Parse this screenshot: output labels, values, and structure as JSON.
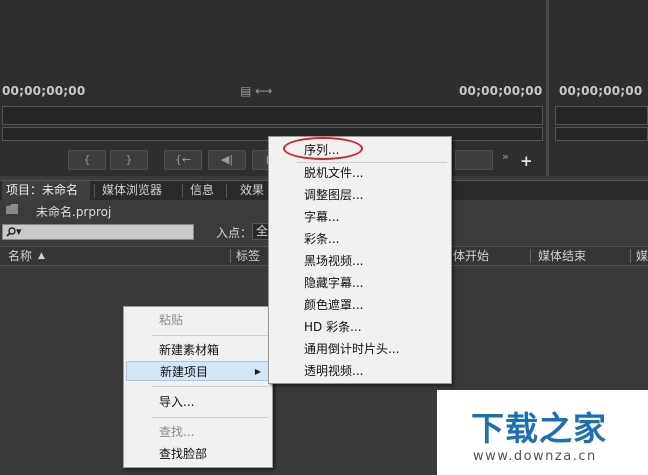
{
  "monitors": {
    "source_timecode": "00;00;00;00",
    "source_timecode_right": "00;00;00;00",
    "program_timecode": "00;00;00;00",
    "transport_buttons": [
      "{",
      "}",
      "{←",
      "◀|",
      "▶"
    ],
    "add_symbol": "+",
    "overflow_symbol": "»",
    "clip_icons": "▤ ⟷"
  },
  "panel": {
    "tabs": [
      {
        "label": "项目：未命名",
        "close": "×"
      },
      {
        "label": "媒体浏览器"
      },
      {
        "label": "信息"
      },
      {
        "label": "效果"
      }
    ],
    "project_file": "未命名.prproj",
    "folder_icon": "folder-icon",
    "search_icon": "▾",
    "in_point_label": "入点：",
    "in_point_value": "全",
    "columns": {
      "name": "名称",
      "sort_arrow": "▲",
      "label": "标签",
      "media_start": "体开始",
      "media_end": "媒体结束",
      "more": "媒"
    }
  },
  "context_menu": {
    "items": [
      {
        "label": "粘贴",
        "disabled": true
      },
      {
        "label": "新建素材箱",
        "disabled": false
      },
      {
        "label": "新建项目",
        "disabled": false,
        "submenu": "▶"
      },
      {
        "label": "导入...",
        "disabled": false
      },
      {
        "label": "查找...",
        "disabled": true
      },
      {
        "label": "查找脸部",
        "disabled": false
      }
    ]
  },
  "submenu": {
    "items": [
      "序列...",
      "脱机文件...",
      "调整图层...",
      "字幕...",
      "彩条...",
      "黑场视频...",
      "隐藏字幕...",
      "颜色遮罩...",
      "HD 彩条...",
      "通用倒计时片头...",
      "透明视频..."
    ],
    "highlight_color": "#d4202a"
  },
  "watermark": {
    "title": "下载之家",
    "url": "www.downza.cn",
    "color": "#1b6fb8"
  }
}
